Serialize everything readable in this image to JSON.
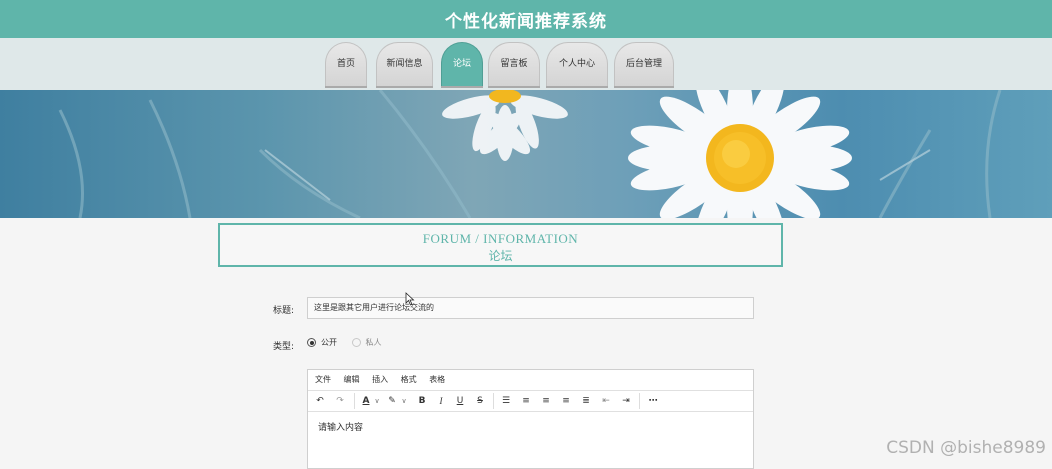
{
  "header": {
    "title": "个性化新闻推荐系统"
  },
  "nav": {
    "items": [
      {
        "label": "首页",
        "active": false
      },
      {
        "label": "新闻信息",
        "active": false
      },
      {
        "label": "论坛",
        "active": true
      },
      {
        "label": "留言板",
        "active": false
      },
      {
        "label": "个人中心",
        "active": false
      },
      {
        "label": "后台管理",
        "active": false
      }
    ]
  },
  "section": {
    "title_en": "FORUM / INFORMATION",
    "title_cn": "论坛"
  },
  "form": {
    "title_label": "标题:",
    "title_value": "这里是跟其它用户进行论坛交流的",
    "type_label": "类型:",
    "type_options": [
      {
        "label": "公开",
        "selected": true
      },
      {
        "label": "私人",
        "selected": false
      }
    ],
    "editor": {
      "menus": [
        "文件",
        "编辑",
        "插入",
        "格式",
        "表格"
      ],
      "placeholder": "请输入内容"
    }
  },
  "watermark": "CSDN @bishe8989",
  "colors": {
    "primary": "#5fb5aa",
    "nav_bg": "#dfe8e9",
    "page_bg": "#f5f5f5"
  }
}
